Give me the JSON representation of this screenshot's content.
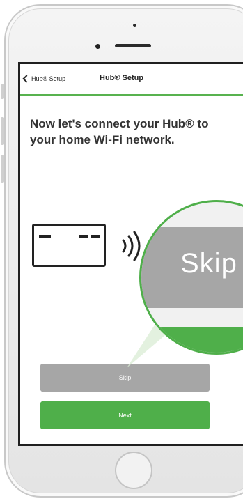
{
  "nav": {
    "back_label": "Hub® Setup",
    "title": "Hub® Setup"
  },
  "main": {
    "heading": "Now let's connect your Hub® to your home Wi-Fi network."
  },
  "buttons": {
    "skip_label": "Skip",
    "next_label": "Next"
  },
  "callout": {
    "label": "Skip"
  },
  "icons": {
    "back": "chevron-left-icon",
    "hub": "hub-device-icon",
    "wifi": "wifi-signal-icon"
  },
  "colors": {
    "accent_green": "#4faf4a",
    "skip_gray": "#a6a6a6",
    "text_dark": "#333333"
  }
}
